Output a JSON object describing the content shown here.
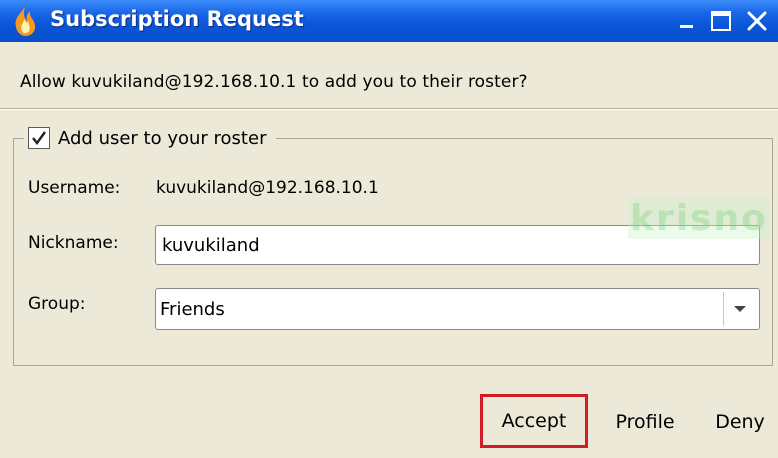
{
  "window": {
    "title": "Subscription Request",
    "icon": "flame-icon",
    "controls": [
      "minimize-icon",
      "maximize-icon",
      "close-icon"
    ]
  },
  "prompt": "Allow kuvukiland@192.168.10.1 to add you to their roster?",
  "roster_group": {
    "checkbox_label": "Add user to your roster",
    "checked": true
  },
  "fields": {
    "username_label": "Username:",
    "username_value": "kuvukiland@192.168.10.1",
    "nickname_label": "Nickname:",
    "nickname_value": "kuvukiland",
    "group_label": "Group:",
    "group_value": "Friends"
  },
  "watermark": "krisno",
  "buttons": {
    "accept": "Accept",
    "profile": "Profile",
    "deny": "Deny"
  },
  "colors": {
    "titlebar": "#0a55d8",
    "window_bg": "#ece9d8",
    "highlight_box": "#d01c24"
  }
}
